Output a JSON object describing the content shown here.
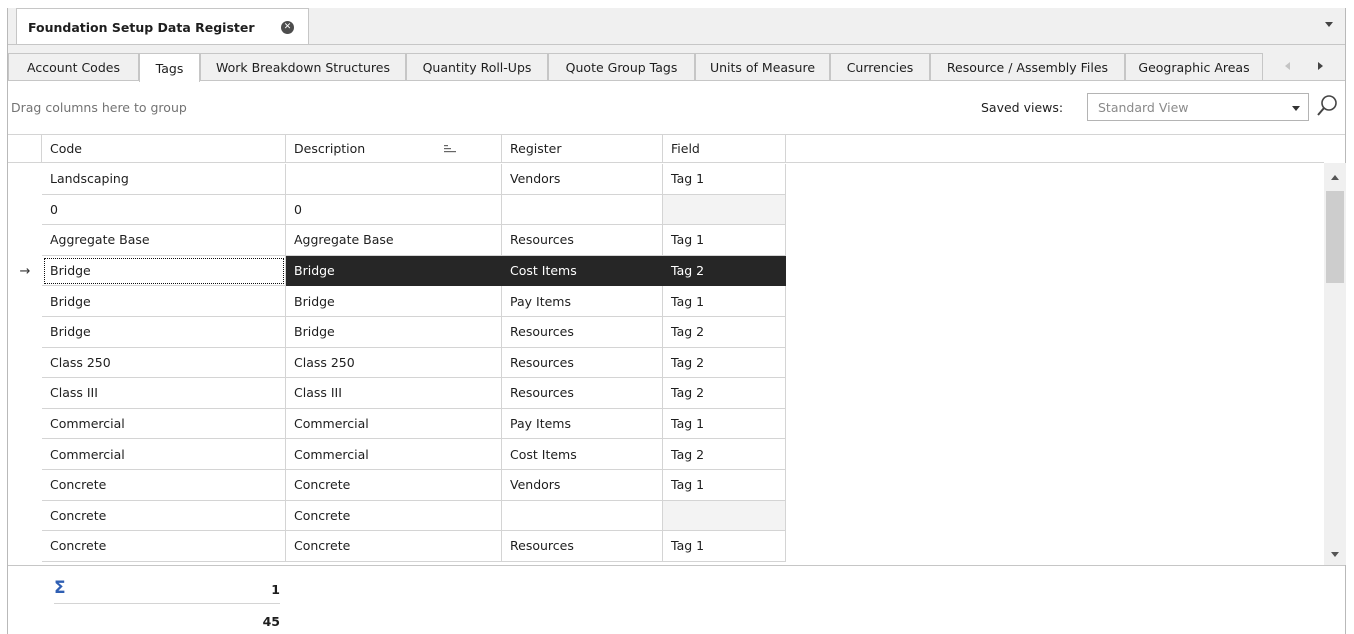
{
  "document": {
    "title": "Foundation Setup Data Register",
    "close_icon": "close-circle-icon",
    "menu_icon": "chevron-down-icon"
  },
  "tabs": [
    {
      "label": "Account Codes",
      "active": false
    },
    {
      "label": "Tags",
      "active": true
    },
    {
      "label": "Work Breakdown Structures",
      "active": false
    },
    {
      "label": "Quantity Roll-Ups",
      "active": false
    },
    {
      "label": "Quote Group Tags",
      "active": false
    },
    {
      "label": "Units of Measure",
      "active": false
    },
    {
      "label": "Currencies",
      "active": false
    },
    {
      "label": "Resource / Assembly Files",
      "active": false
    },
    {
      "label": "Geographic Areas",
      "active": false
    }
  ],
  "toolbar": {
    "group_hint": "Drag columns here to group",
    "saved_views_label": "Saved views:",
    "saved_views_value": "Standard View"
  },
  "grid": {
    "columns": [
      "Code",
      "Description",
      "Register",
      "Field"
    ],
    "rows": [
      {
        "code": "Landscaping",
        "description": "",
        "register": "Vendors",
        "field": "Tag 1"
      },
      {
        "code": "0",
        "description": "0",
        "register": "",
        "field": ""
      },
      {
        "code": "Aggregate Base",
        "description": "Aggregate Base",
        "register": "Resources",
        "field": "Tag 1"
      },
      {
        "code": "Bridge",
        "description": "Bridge",
        "register": "Cost Items",
        "field": "Tag 2",
        "selected": true,
        "indicator": "→"
      },
      {
        "code": "Bridge",
        "description": "Bridge",
        "register": "Pay Items",
        "field": "Tag 1"
      },
      {
        "code": "Bridge",
        "description": "Bridge",
        "register": "Resources",
        "field": "Tag 2"
      },
      {
        "code": "Class 250",
        "description": "Class 250",
        "register": "Resources",
        "field": "Tag 2"
      },
      {
        "code": "Class III",
        "description": "Class III",
        "register": "Resources",
        "field": "Tag 2"
      },
      {
        "code": "Commercial",
        "description": "Commercial",
        "register": "Pay Items",
        "field": "Tag 1"
      },
      {
        "code": "Commercial",
        "description": "Commercial",
        "register": "Cost Items",
        "field": "Tag 2"
      },
      {
        "code": "Concrete",
        "description": "Concrete",
        "register": "Vendors",
        "field": "Tag 1"
      },
      {
        "code": "Concrete",
        "description": "Concrete",
        "register": "",
        "field": ""
      },
      {
        "code": "Concrete",
        "description": "Concrete",
        "register": "Resources",
        "field": "Tag 1"
      }
    ]
  },
  "footer": {
    "sigma_icon": "sigma-icon",
    "summary_values": [
      "1",
      "45"
    ]
  },
  "colors": {
    "selection": "#262626",
    "sigma": "#2f5fb3"
  }
}
